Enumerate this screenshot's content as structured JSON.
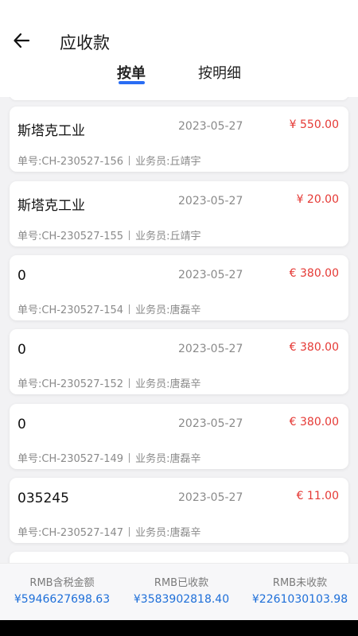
{
  "header": {
    "title": "应收款",
    "tabs": [
      {
        "label": "按单"
      },
      {
        "label": "按明细"
      }
    ]
  },
  "icons": {
    "back": "arrow-left-icon"
  },
  "orders": [
    {
      "customer": "斯塔克工业",
      "date": "2023-05-27",
      "amount": "¥ 550.00",
      "order_no": "单号:CH-230527-156",
      "salesperson": "业务员:丘靖宇"
    },
    {
      "customer": "斯塔克工业",
      "date": "2023-05-27",
      "amount": "¥ 20.00",
      "order_no": "单号:CH-230527-155",
      "salesperson": "业务员:丘靖宇"
    },
    {
      "customer": "0",
      "date": "2023-05-27",
      "amount": "€ 380.00",
      "order_no": "单号:CH-230527-154",
      "salesperson": "业务员:唐磊辛"
    },
    {
      "customer": "0",
      "date": "2023-05-27",
      "amount": "€ 380.00",
      "order_no": "单号:CH-230527-152",
      "salesperson": "业务员:唐磊辛"
    },
    {
      "customer": "0",
      "date": "2023-05-27",
      "amount": "€ 380.00",
      "order_no": "单号:CH-230527-149",
      "salesperson": "业务员:唐磊辛"
    },
    {
      "customer": "035245",
      "date": "2023-05-27",
      "amount": "€ 11.00",
      "order_no": "单号:CH-230527-147",
      "salesperson": "业务员:唐磊辛"
    }
  ],
  "footer": {
    "total_label": "RMB含税金额",
    "total_value": "¥5946627698.63",
    "received_label": "RMB已收款",
    "received_value": "¥3583902818.40",
    "unreceived_label": "RMB未收款",
    "unreceived_value": "¥2261030103.98"
  },
  "colors": {
    "accent": "#2a6df4",
    "amount": "#e53935",
    "footer_value": "#1e6fd9"
  }
}
